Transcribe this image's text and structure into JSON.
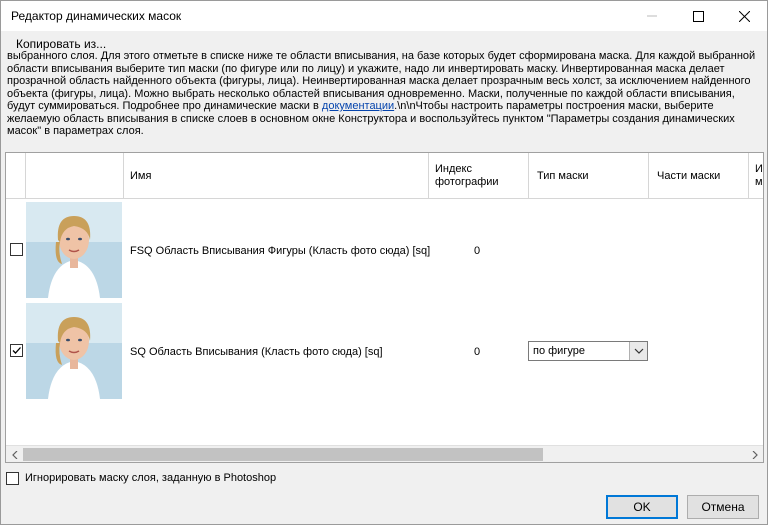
{
  "window": {
    "title": "Редактор динамических масок"
  },
  "menu": {
    "copy_from": "Копировать из..."
  },
  "description": {
    "line_top": "выбранного слоя. Для этого отметьте в списке ниже те области вписывания, на базе которых будет сформирована маска. Для каждой выбранной области вписывания выберите тип маски (по фигуре или по лицу) и укажите, надо ли инвертировать маску. Инвертированная маска делает прозрачной область найденного объекта (фигуры, лица). Неинвертированная маска делает прозрачным весь холст, за исключением найденного объекта (фигуры, лица). Можно выбрать несколько областей вписывания одновременно. Маски, полученные по каждой области вписывания, будут суммироваться. Подробнее про динамические маски в ",
    "link": "документации",
    "line_after": ".\\n\\nЧтобы настроить параметры построения маски, выберите желаемую область вписывания в списке слоев в основном окне Конструктора и воспользуйтесь пунктом \"Параметры создания динамических масок\" в параметрах слоя."
  },
  "grid": {
    "columns": {
      "name": "Имя",
      "photo_index": "Индекс фотографии",
      "mask_type": "Тип маски",
      "mask_parts": "Части маски",
      "invert": "Ин ма"
    },
    "rows": [
      {
        "checked": false,
        "name": "FSQ Область Вписывания Фигуры (Класть фото сюда) [sq]",
        "photo_index": "0",
        "mask_type": ""
      },
      {
        "checked": true,
        "name": "SQ Область Вписывания (Класть фото сюда) [sq]",
        "photo_index": "0",
        "mask_type": "по фигуре"
      }
    ]
  },
  "footer": {
    "ignore_label": "Игнорировать маску слоя, заданную в Photoshop",
    "ok": "OK",
    "cancel": "Отмена"
  },
  "colors": {
    "accent": "#0078d7",
    "link": "#0645ad"
  }
}
